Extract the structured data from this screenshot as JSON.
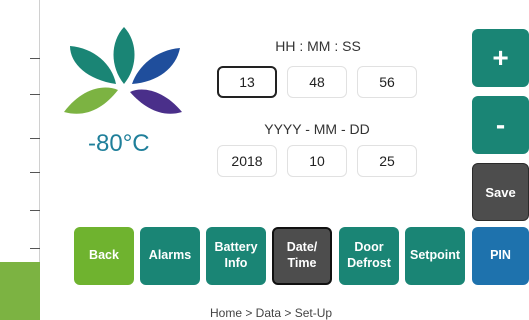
{
  "temperature": "-80°C",
  "time": {
    "label": "HH : MM : SS",
    "hours": "13",
    "minutes": "48",
    "seconds": "56"
  },
  "date": {
    "label": "YYYY - MM - DD",
    "year": "2018",
    "month": "10",
    "day": "25"
  },
  "side_buttons": {
    "increment": "+",
    "decrement": "-",
    "save": "Save"
  },
  "nav": {
    "back": "Back",
    "alarms": "Alarms",
    "battery_info": "Battery\nInfo",
    "date_time": "Date/\nTime",
    "door_defrost": "Door\nDefrost",
    "setpoint": "Setpoint",
    "pin": "PIN"
  },
  "breadcrumb": "Home > Data > Set-Up",
  "colors": {
    "teal": "#1a8575",
    "green": "#6fb32f",
    "dark": "#4d4d4d",
    "blue": "#1e72ad",
    "purple": "#4a2f8a",
    "navy": "#1f4e9c"
  }
}
